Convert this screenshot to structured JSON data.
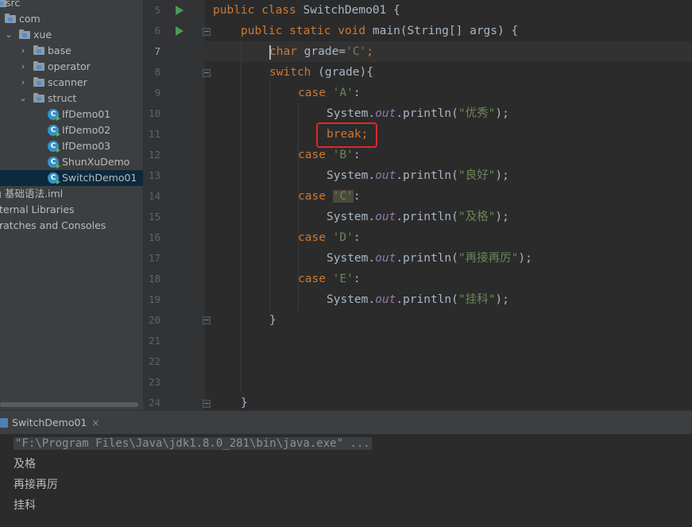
{
  "project_tree": {
    "items": [
      {
        "label": "src",
        "icon": "folder-icon",
        "indent": 0
      },
      {
        "label": "com",
        "icon": "folder-icon",
        "indent": 0
      },
      {
        "label": "xue",
        "icon": "folder-icon",
        "indent": 1
      },
      {
        "label": "base",
        "icon": "folder-icon",
        "indent": 2
      },
      {
        "label": "operator",
        "icon": "folder-icon",
        "indent": 2
      },
      {
        "label": "scanner",
        "icon": "folder-icon",
        "indent": 2
      },
      {
        "label": "struct",
        "icon": "folder-icon",
        "indent": 2
      },
      {
        "label": "IfDemo01",
        "icon": "java-class-icon",
        "indent": 3
      },
      {
        "label": "IfDemo02",
        "icon": "java-class-icon",
        "indent": 3
      },
      {
        "label": "IfDemo03",
        "icon": "java-class-icon",
        "indent": 3
      },
      {
        "label": "ShunXuDemo",
        "icon": "java-class-icon",
        "indent": 3
      },
      {
        "label": "SwitchDemo01",
        "icon": "java-class-icon",
        "indent": 3,
        "selected": true
      },
      {
        "label": "基础语法.iml",
        "icon": "iml-file-icon",
        "indent": 0
      },
      {
        "label": "ternal Libraries",
        "icon": "library-icon",
        "indent": 0
      },
      {
        "label": "ratches and Consoles",
        "icon": "scratch-icon",
        "indent": 0
      }
    ]
  },
  "editor": {
    "line_numbers": [
      "5",
      "6",
      "7",
      "8",
      "9",
      "10",
      "11",
      "12",
      "13",
      "14",
      "15",
      "16",
      "17",
      "18",
      "19",
      "20",
      "21",
      "22",
      "23",
      "24"
    ],
    "current_line": "7",
    "code": {
      "l5_kw": "public class ",
      "l5_rest": "SwitchDemo01 {",
      "l6_kw": "public static void ",
      "l6_rest": "main(String[] args) {",
      "l7_kw": "char ",
      "l7_mid": "grade=",
      "l7_str": "'C'",
      "l7_end": ";",
      "l8_kw": "switch ",
      "l8_rest": "(grade){",
      "case_kw": "case ",
      "colon": ":",
      "l9_str": "'A'",
      "println_pre": "System.",
      "println_out": "out",
      "println_mid": ".println(",
      "println_end": ");",
      "l10_str": "\"优秀\"",
      "l11_kw": "break",
      "semicolon": ";",
      "l12_str": "'B'",
      "l13_str": "\"良好\"",
      "l14_str": "'C'",
      "l15_str": "\"及格\"",
      "l16_str": "'D'",
      "l17_str": "\"再接再厉\"",
      "l18_str": "'E'",
      "l19_str": "\"挂科\"",
      "l20": "}",
      "l24": "}"
    }
  },
  "run_panel": {
    "tab_label": "SwitchDemo01",
    "tab_close": "×",
    "output": {
      "command": "\"F:\\Program Files\\Java\\jdk1.8.0_281\\bin\\java.exe\" ...",
      "lines": [
        "及格",
        "再接再厉",
        "挂科"
      ]
    }
  },
  "colors": {
    "keyword": "#cc7832",
    "string": "#6a8759",
    "field": "#9876aa",
    "text": "#a9b7c6",
    "annotation_box": "#e3262c",
    "run_icon": "#499c54"
  }
}
